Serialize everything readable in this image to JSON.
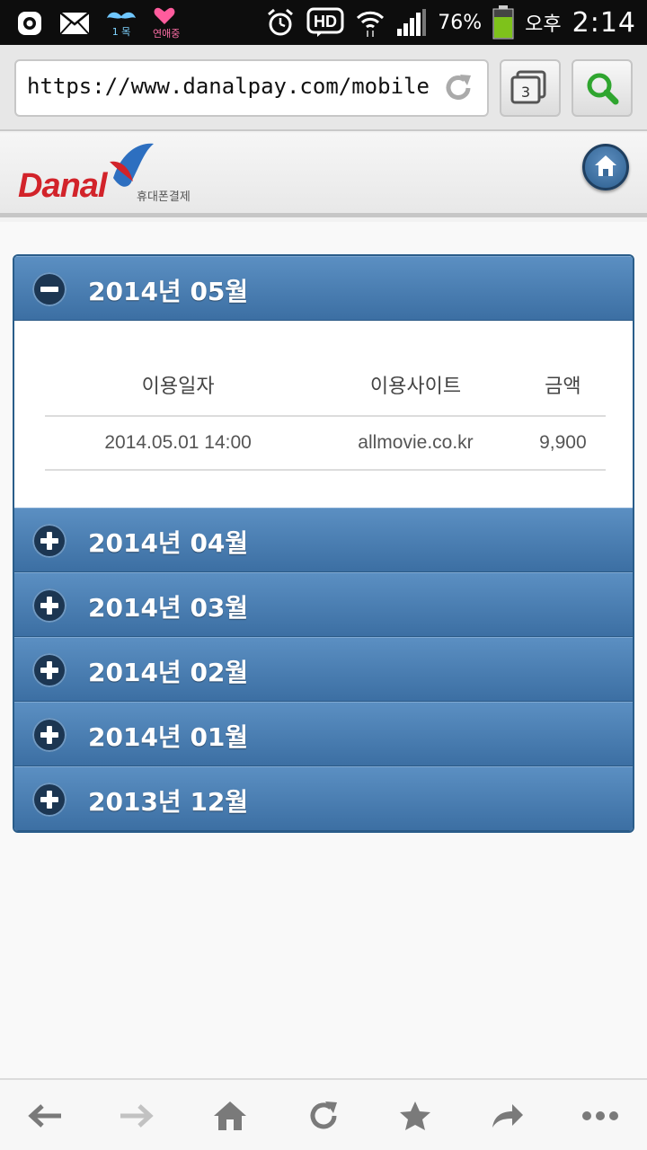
{
  "status_bar": {
    "notif_1_label": "1 목",
    "notif_2_label": "연애중",
    "battery": "76%",
    "time_period": "오후",
    "time": "2:14"
  },
  "browser": {
    "url": "https://www.danalpay.com/mobile",
    "tab_count": "3"
  },
  "site": {
    "logo_text": "Danal",
    "logo_subtitle": "휴대폰결제"
  },
  "accordion": {
    "sections": [
      {
        "title": "2014년 05월",
        "expanded": true
      },
      {
        "title": "2014년 04월",
        "expanded": false
      },
      {
        "title": "2014년 03월",
        "expanded": false
      },
      {
        "title": "2014년 02월",
        "expanded": false
      },
      {
        "title": "2014년 01월",
        "expanded": false
      },
      {
        "title": "2013년 12월",
        "expanded": false
      }
    ],
    "table": {
      "headers": [
        "이용일자",
        "이용사이트",
        "금액"
      ],
      "rows": [
        [
          "2014.05.01 14:00",
          "allmovie.co.kr",
          "9,900"
        ]
      ]
    }
  },
  "colors": {
    "accent": "#3c6fa3",
    "logo_red": "#d2232a",
    "search_green": "#2fa52f"
  }
}
